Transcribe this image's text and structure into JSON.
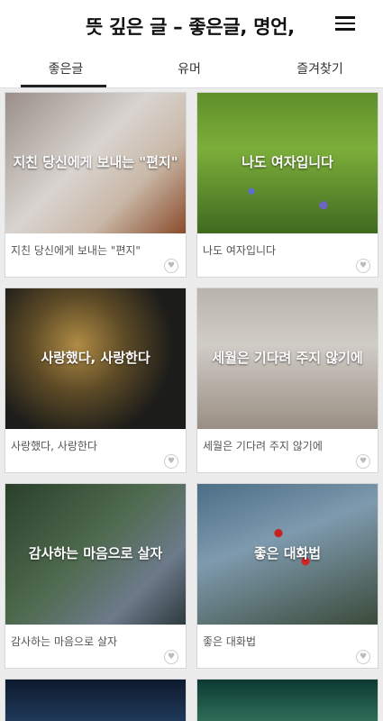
{
  "app": {
    "title": "뜻 깊은 글 – 좋은글, 명언,"
  },
  "icons": {
    "menu": "hamburger-menu-icon",
    "favorite": "heart-icon"
  },
  "tabs": [
    {
      "label": "좋은글",
      "active": true
    },
    {
      "label": "유머",
      "active": false
    },
    {
      "label": "즐겨찾기",
      "active": false
    }
  ],
  "cards": [
    {
      "overlay": "지친 당신에게 보내는 \"편지\"",
      "caption": "지친 당신에게 보내는 \"편지\"",
      "image": "dove-photo"
    },
    {
      "overlay": "나도 여자입니다",
      "caption": "나도 여자입니다",
      "image": "flowers-photo"
    },
    {
      "overlay": "사랑했다, 사랑한다",
      "caption": "사랑했다, 사랑한다",
      "image": "leaf-photo"
    },
    {
      "overlay": "세월은 기다려 주지 않기에",
      "caption": "세월은 기다려 주지 않기에",
      "image": "couple-photo"
    },
    {
      "overlay": "감사하는 마음으로 살자",
      "caption": "감사하는 마음으로 살자",
      "image": "hug-photo"
    },
    {
      "overlay": "좋은 대화법",
      "caption": "좋은 대화법",
      "image": "berries-photo"
    }
  ],
  "colors": {
    "tab_indicator": "#222222",
    "background": "#ececec"
  }
}
